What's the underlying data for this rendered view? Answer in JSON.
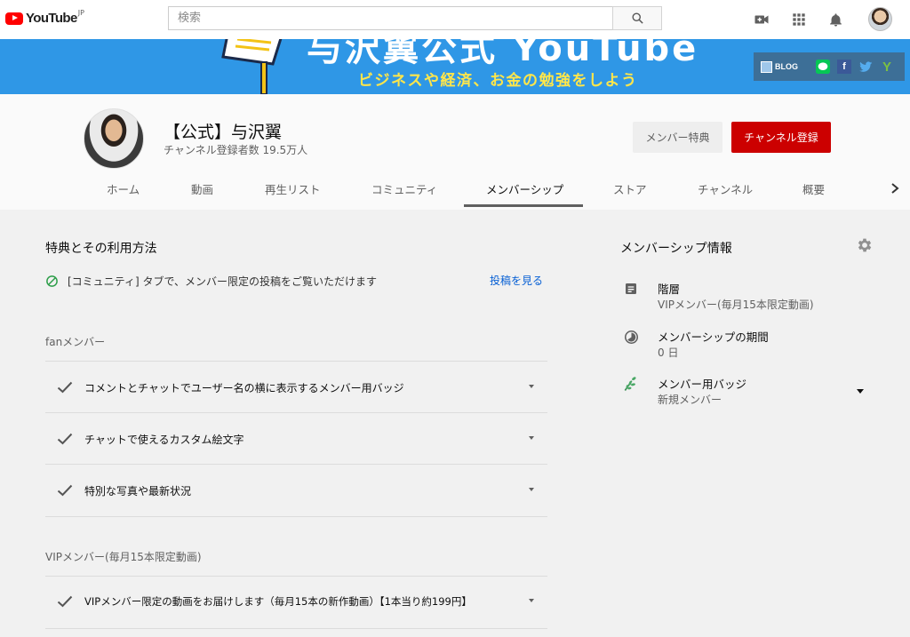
{
  "header": {
    "logo_text": "YouTube",
    "logo_region": "JP",
    "search_placeholder": "検索"
  },
  "banner": {
    "title": "与沢翼公式 YouTube",
    "subtitle": "ビジネスや経済、お金の勉強をしよう",
    "links": {
      "blog": "BLOG",
      "facebook": "f",
      "yahoo": "Y"
    }
  },
  "channel": {
    "name": "【公式】与沢翼",
    "subscribers": "チャンネル登録者数 19.5万人",
    "member_perks_button": "メンバー特典",
    "subscribe_button": "チャンネル登録",
    "tabs": [
      "ホーム",
      "動画",
      "再生リスト",
      "コミュニティ",
      "メンバーシップ",
      "ストア",
      "チャンネル",
      "概要"
    ],
    "active_tab": "メンバーシップ"
  },
  "benefits": {
    "title": "特典とその利用方法",
    "community_note": "[コミュニティ] タブで、メンバー限定の投稿をご覧いただけます",
    "view_posts_link": "投稿を見る",
    "tiers": [
      {
        "name": "fanメンバー",
        "perks": [
          "コメントとチャットでユーザー名の横に表示するメンバー用バッジ",
          "チャットで使えるカスタム絵文字",
          "特別な写真や最新状況"
        ]
      },
      {
        "name": "VIPメンバー(毎月15本限定動画)",
        "perks": [
          "VIPメンバー限定の動画をお届けします（毎月15本の新作動画）【1本当り約199円】"
        ]
      }
    ]
  },
  "membership_info": {
    "title": "メンバーシップ情報",
    "level_label": "階層",
    "level_value": "VIPメンバー(毎月15本限定動画)",
    "duration_label": "メンバーシップの期間",
    "duration_value": "0 日",
    "badge_label": "メンバー用バッジ",
    "badge_value": "新規メンバー"
  },
  "colors": {
    "brand_red": "#ff0000",
    "subscribe_red": "#cc0000",
    "link_blue": "#065fd4",
    "banner_blue": "#2f97e6",
    "banner_yellow": "#ffe64a"
  }
}
